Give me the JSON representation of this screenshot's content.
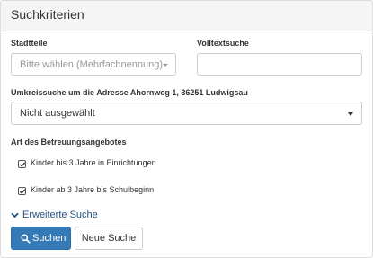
{
  "panel": {
    "title": "Suchkriterien"
  },
  "form": {
    "districts": {
      "label": "Stadtteile",
      "placeholder": "Bitte wählen (Mehrfachnennung)"
    },
    "fulltext": {
      "label": "Volltextsuche",
      "value": ""
    },
    "radius": {
      "label": "Umkreissuche um die Adresse Ahornweg 1, 36251 Ludwigsau",
      "selected": "Nicht ausgewählt"
    },
    "care_type": {
      "label": "Art des Betreuungsangebotes",
      "options": [
        {
          "label": "Kinder bis 3 Jahre in Einrichtungen",
          "checked": true
        },
        {
          "label": "Kinder ab 3 Jahre bis Schulbeginn",
          "checked": true
        }
      ]
    },
    "advanced_search": {
      "label": "Erweiterte Suche",
      "icon": "chevron-down-icon"
    }
  },
  "buttons": {
    "search": {
      "label": "Suchen",
      "icon": "search-icon"
    },
    "reset": {
      "label": "Neue Suche"
    }
  },
  "colors": {
    "primary": "#337ab7",
    "link": "#23527c",
    "border": "#cccccc",
    "heading_bg": "#f5f5f5"
  }
}
